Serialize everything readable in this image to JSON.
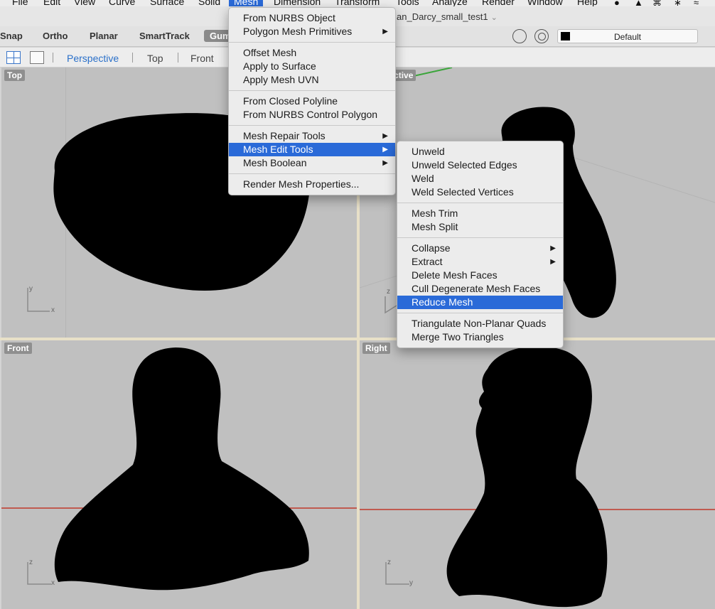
{
  "menubar": {
    "items": [
      "File",
      "Edit",
      "View",
      "Curve",
      "Surface",
      "Solid",
      "Mesh",
      "Dimension",
      "Transform",
      "Tools",
      "Analyze",
      "Render",
      "Window",
      "Help"
    ],
    "active": "Mesh"
  },
  "document": {
    "title": "an_Darcy_small_test1"
  },
  "toolbar": {
    "buttons": [
      "Snap",
      "Ortho",
      "Planar",
      "SmartTrack",
      "Gum"
    ],
    "layer": "Default",
    "layer_color": "#000000"
  },
  "view_tabs": [
    "Perspective",
    "Top",
    "Front"
  ],
  "viewports": {
    "top": {
      "label": "Top",
      "axis_a": "y",
      "axis_b": "x"
    },
    "perspective": {
      "label": "Perspective",
      "axis_a": "z"
    },
    "front": {
      "label": "Front",
      "axis_a": "z",
      "axis_b": "x"
    },
    "right": {
      "label": "Right",
      "axis_a": "z",
      "axis_b": "y"
    }
  },
  "mesh_menu": {
    "groups": [
      [
        {
          "label": "From NURBS Object"
        },
        {
          "label": "Polygon Mesh Primitives",
          "submenu": true
        }
      ],
      [
        {
          "label": "Offset Mesh"
        },
        {
          "label": "Apply to Surface"
        },
        {
          "label": "Apply Mesh UVN"
        }
      ],
      [
        {
          "label": "From Closed Polyline"
        },
        {
          "label": "From NURBS Control Polygon"
        }
      ],
      [
        {
          "label": "Mesh Repair Tools",
          "submenu": true
        },
        {
          "label": "Mesh Edit Tools",
          "submenu": true,
          "highlighted": true
        },
        {
          "label": "Mesh Boolean",
          "submenu": true
        }
      ],
      [
        {
          "label": "Render Mesh Properties..."
        }
      ]
    ]
  },
  "mesh_edit_submenu": {
    "groups": [
      [
        {
          "label": "Unweld"
        },
        {
          "label": "Unweld Selected Edges"
        },
        {
          "label": "Weld"
        },
        {
          "label": "Weld Selected Vertices"
        }
      ],
      [
        {
          "label": "Mesh Trim"
        },
        {
          "label": "Mesh Split"
        }
      ],
      [
        {
          "label": "Collapse",
          "submenu": true
        },
        {
          "label": "Extract",
          "submenu": true
        },
        {
          "label": "Delete Mesh Faces"
        },
        {
          "label": "Cull Degenerate Mesh Faces"
        },
        {
          "label": "Reduce Mesh",
          "highlighted": true
        }
      ],
      [
        {
          "label": "Triangulate Non-Planar Quads"
        },
        {
          "label": "Merge Two Triangles"
        }
      ]
    ]
  },
  "colors": {
    "accent": "#2a6ad8",
    "viewport_bg": "#c0c0c0",
    "x_axis": "#c0392b",
    "y_axis": "#3aa53a"
  }
}
